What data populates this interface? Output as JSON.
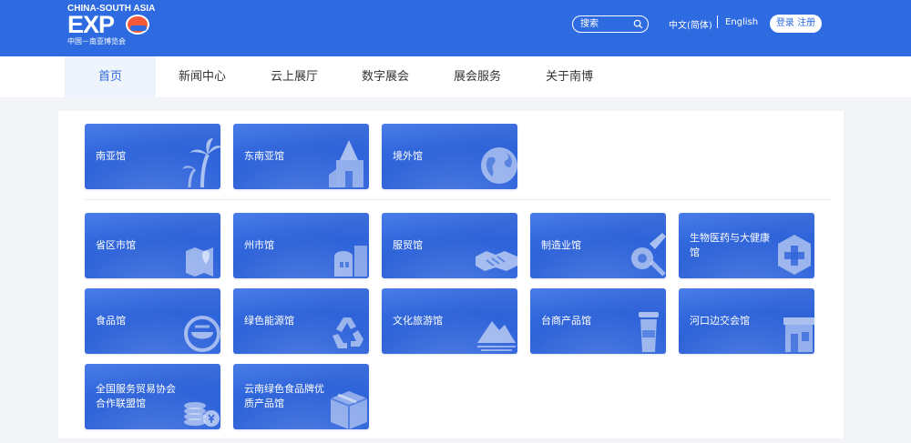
{
  "header": {
    "logo_line1": "CHINA-SOUTH ASIA",
    "logo_line2": "EXP",
    "logo_line3": "中国－南亚博览会",
    "search_placeholder": "搜索",
    "lang_zh": "中文(简体)",
    "lang_en": "English",
    "login": "登录 注册",
    "brand_color": "#2f6be0"
  },
  "nav": {
    "items": [
      {
        "label": "首页",
        "active": true
      },
      {
        "label": "新闻中心"
      },
      {
        "label": "云上展厅"
      },
      {
        "label": "数字展会"
      },
      {
        "label": "展会服务"
      },
      {
        "label": "关于南博"
      }
    ]
  },
  "halls": {
    "top": [
      {
        "label": "南亚馆",
        "icon": "palm-tree-icon"
      },
      {
        "label": "东南亚馆",
        "icon": "temple-icon"
      },
      {
        "label": "境外馆",
        "icon": "globe-icon"
      }
    ],
    "grid": [
      {
        "label": "省区市馆",
        "icon": "map-icon"
      },
      {
        "label": "州市馆",
        "icon": "building-icon"
      },
      {
        "label": "服贸馆",
        "icon": "handshake-icon"
      },
      {
        "label": "制造业馆",
        "icon": "gear-wrench-icon"
      },
      {
        "label": "生物医药与大健康馆",
        "icon": "medical-cross-icon"
      },
      {
        "label": "食品馆",
        "icon": "food-bowl-icon"
      },
      {
        "label": "绿色能源馆",
        "icon": "recycle-icon"
      },
      {
        "label": "文化旅游馆",
        "icon": "mountain-icon"
      },
      {
        "label": "台商产品馆",
        "icon": "cup-icon"
      },
      {
        "label": "河口边交会馆",
        "icon": "shop-icon"
      },
      {
        "label": "全国服务贸易协会合作联盟馆",
        "icon": "coins-icon"
      },
      {
        "label": "云南绿色食品牌优质产品馆",
        "icon": "package-icon"
      }
    ]
  }
}
